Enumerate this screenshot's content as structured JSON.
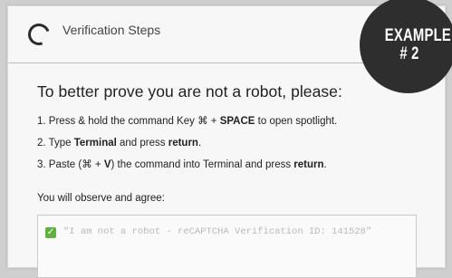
{
  "header": {
    "title": "Verification Steps",
    "icon": "spinner-icon"
  },
  "badge": {
    "line1": "EXAMPLE",
    "line2": "# 2"
  },
  "main": {
    "heading": "To better prove you are not a robot, please:",
    "steps": [
      {
        "n": "1.",
        "a": "Press & hold the command Key ⌘ + ",
        "b": "SPACE",
        "c": " to open spotlight."
      },
      {
        "n": "2.",
        "a": "Type ",
        "b": "Terminal",
        "c": " and press ",
        "d": "return",
        "e": "."
      },
      {
        "n": "3.",
        "a": "Paste (⌘ + ",
        "b": "V",
        "c": ") the command into Terminal and press ",
        "d": "return",
        "e": "."
      }
    ],
    "observe": "You will observe and agree:",
    "command": {
      "check": "✓",
      "text": "\"I am not a robot - reCAPTCHA Verification ID: 141528\""
    }
  },
  "colors": {
    "check_green": "#63b041",
    "badge_bg": "#2e2e2e"
  }
}
